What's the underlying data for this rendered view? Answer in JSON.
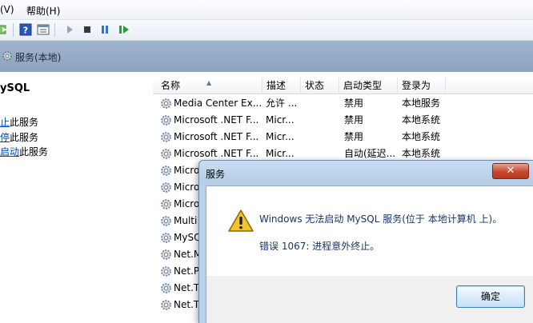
{
  "menu": {
    "items": [
      "(V)",
      "帮助(H)"
    ]
  },
  "toolbar": {
    "buttons": [
      "back-icon",
      "help-icon",
      "properties-icon",
      "start-service-icon",
      "stop-service-icon",
      "pause-service-icon",
      "resume-service-icon"
    ]
  },
  "header": {
    "title": "服务(本地)"
  },
  "left_pane": {
    "service_name": "ySQL",
    "actions": [
      {
        "link": "止",
        "suffix": "此服务"
      },
      {
        "link": "停",
        "suffix": "此服务"
      },
      {
        "link": "启动",
        "suffix": "此服务"
      }
    ]
  },
  "table": {
    "columns": [
      "名称",
      "描述",
      "状态",
      "启动类型",
      "登录为"
    ],
    "rows": [
      {
        "name": "Media Center Ex...",
        "desc": "允许 ...",
        "status": "",
        "startup": "禁用",
        "logon": "本地服务"
      },
      {
        "name": "Microsoft .NET F...",
        "desc": "Micr...",
        "status": "",
        "startup": "禁用",
        "logon": "本地系统"
      },
      {
        "name": "Microsoft .NET F...",
        "desc": "Micr...",
        "status": "",
        "startup": "禁用",
        "logon": "本地系统"
      },
      {
        "name": "Microsoft .NET F...",
        "desc": "Micr...",
        "status": "",
        "startup": "自动(延迟...",
        "logon": "本地系统"
      },
      {
        "name": "Micro",
        "desc": "",
        "status": "",
        "startup": "",
        "logon": ""
      },
      {
        "name": "Micro",
        "desc": "",
        "status": "",
        "startup": "",
        "logon": ""
      },
      {
        "name": "Micro",
        "desc": "",
        "status": "",
        "startup": "",
        "logon": ""
      },
      {
        "name": "Multi",
        "desc": "",
        "status": "",
        "startup": "",
        "logon": ""
      },
      {
        "name": "MySQ",
        "desc": "",
        "status": "",
        "startup": "",
        "logon": ""
      },
      {
        "name": "Net.M",
        "desc": "",
        "status": "",
        "startup": "",
        "logon": ""
      },
      {
        "name": "Net.P",
        "desc": "",
        "status": "",
        "startup": "",
        "logon": ""
      },
      {
        "name": "Net.T",
        "desc": "",
        "status": "",
        "startup": "",
        "logon": ""
      },
      {
        "name": "Net.T",
        "desc": "",
        "status": "",
        "startup": "",
        "logon": ""
      }
    ]
  },
  "dialog": {
    "title": "服务",
    "close_label": "✕",
    "message_line1": "Windows 无法启动 MySQL 服务(位于 本地计算机 上)。",
    "message_line2": "错误 1067: 进程意外终止。",
    "ok_label": "确定",
    "icon": "warning-icon"
  }
}
